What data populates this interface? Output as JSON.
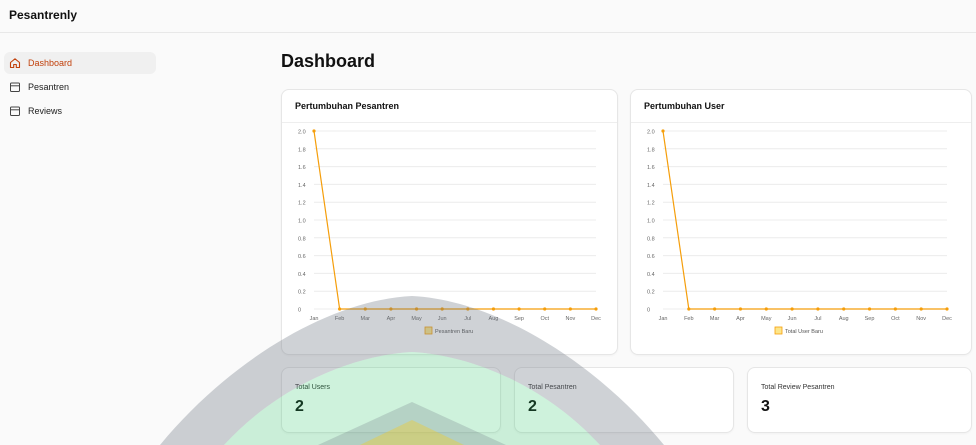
{
  "app": {
    "brand": "Pesantrenly"
  },
  "sidebar": {
    "items": [
      {
        "label": "Dashboard",
        "icon": "home-icon",
        "active": true
      },
      {
        "label": "Pesantren",
        "icon": "archive-icon",
        "active": false
      },
      {
        "label": "Reviews",
        "icon": "archive-icon",
        "active": false
      }
    ]
  },
  "main": {
    "title": "Dashboard"
  },
  "charts": {
    "pesantren": {
      "title": "Pertumbuhan Pesantren"
    },
    "user": {
      "title": "Pertumbuhan User"
    }
  },
  "chart_data": [
    {
      "type": "line",
      "categories": [
        "Jan",
        "Feb",
        "Mar",
        "Apr",
        "May",
        "Jun",
        "Jul",
        "Aug",
        "Sep",
        "Oct",
        "Nov",
        "Dec"
      ],
      "series": [
        {
          "name": "Pesantren Baru",
          "values": [
            2,
            0,
            0,
            0,
            0,
            0,
            0,
            0,
            0,
            0,
            0,
            0
          ]
        }
      ],
      "title": "Pertumbuhan Pesantren",
      "ylim": [
        0,
        2
      ],
      "yticks": [
        "0",
        "0.2",
        "0.4",
        "0.6",
        "0.8",
        "1.0",
        "1.2",
        "1.4",
        "1.6",
        "1.8",
        "2.0"
      ],
      "grid": true,
      "legend": "bottom",
      "color": "#f59e0b"
    },
    {
      "type": "line",
      "categories": [
        "Jan",
        "Feb",
        "Mar",
        "Apr",
        "May",
        "Jun",
        "Jul",
        "Aug",
        "Sep",
        "Oct",
        "Nov",
        "Dec"
      ],
      "series": [
        {
          "name": "Total User Baru",
          "values": [
            2,
            0,
            0,
            0,
            0,
            0,
            0,
            0,
            0,
            0,
            0,
            0
          ]
        }
      ],
      "title": "Pertumbuhan User",
      "ylim": [
        0,
        2
      ],
      "yticks": [
        "0",
        "0.2",
        "0.4",
        "0.6",
        "0.8",
        "1.0",
        "1.2",
        "1.4",
        "1.6",
        "1.8",
        "2.0"
      ],
      "grid": true,
      "legend": "bottom",
      "color": "#f59e0b"
    }
  ],
  "stats": [
    {
      "label": "Total Users",
      "value": "2"
    },
    {
      "label": "Total Pesantren",
      "value": "2"
    },
    {
      "label": "Total Review Pesantren",
      "value": "3"
    }
  ]
}
